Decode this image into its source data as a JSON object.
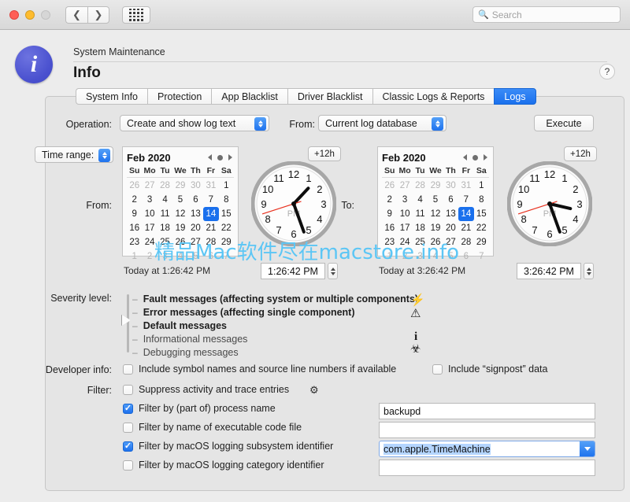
{
  "window": {
    "search_placeholder": "Search",
    "search_icon": "search-icon",
    "nav_back_icon": "chevron-left-icon",
    "nav_forward_icon": "chevron-right-icon",
    "grid_icon": "grid-dots-icon"
  },
  "header": {
    "breadcrumb": "System Maintenance",
    "title": "Info",
    "help_label": "?",
    "app_icon_glyph": "i"
  },
  "tabs": [
    {
      "label": "System Info",
      "active": false
    },
    {
      "label": "Protection",
      "active": false
    },
    {
      "label": "App Blacklist",
      "active": false
    },
    {
      "label": "Driver Blacklist",
      "active": false
    },
    {
      "label": "Classic Logs & Reports",
      "active": false
    },
    {
      "label": "Logs",
      "active": true
    }
  ],
  "toolbar": {
    "operation_label": "Operation:",
    "operation_value": "Create and show log text",
    "from_label": "From:",
    "from_value": "Current log database",
    "execute_label": "Execute"
  },
  "time_range": {
    "popup_label": "Time range:",
    "from_label": "From:",
    "to_label": "To:",
    "plus12_label": "+12h"
  },
  "calendar_from": {
    "month": "Feb 2020",
    "dow": [
      "Su",
      "Mo",
      "Tu",
      "We",
      "Th",
      "Fr",
      "Sa"
    ],
    "weeks": [
      [
        {
          "d": "26",
          "out": true
        },
        {
          "d": "27",
          "out": true
        },
        {
          "d": "28",
          "out": true
        },
        {
          "d": "29",
          "out": true
        },
        {
          "d": "30",
          "out": true
        },
        {
          "d": "31",
          "out": true
        },
        {
          "d": "1"
        }
      ],
      [
        {
          "d": "2"
        },
        {
          "d": "3"
        },
        {
          "d": "4"
        },
        {
          "d": "5"
        },
        {
          "d": "6"
        },
        {
          "d": "7"
        },
        {
          "d": "8"
        }
      ],
      [
        {
          "d": "9"
        },
        {
          "d": "10"
        },
        {
          "d": "11"
        },
        {
          "d": "12"
        },
        {
          "d": "13"
        },
        {
          "d": "14",
          "sel": true
        },
        {
          "d": "15"
        }
      ],
      [
        {
          "d": "16"
        },
        {
          "d": "17"
        },
        {
          "d": "18"
        },
        {
          "d": "19"
        },
        {
          "d": "20"
        },
        {
          "d": "21"
        },
        {
          "d": "22"
        }
      ],
      [
        {
          "d": "23"
        },
        {
          "d": "24"
        },
        {
          "d": "25"
        },
        {
          "d": "26"
        },
        {
          "d": "27"
        },
        {
          "d": "28"
        },
        {
          "d": "29"
        }
      ],
      [
        {
          "d": "1",
          "out": true
        },
        {
          "d": "2",
          "out": true
        },
        {
          "d": "3",
          "out": true
        },
        {
          "d": "4",
          "out": true
        },
        {
          "d": "5",
          "out": true
        },
        {
          "d": "6",
          "out": true
        },
        {
          "d": "7",
          "out": true
        }
      ]
    ],
    "today_text": "Today at 1:26:42 PM",
    "time_value": "1:26:42 PM",
    "clock_meridiem": "PM",
    "clock_hour": 1,
    "clock_minute": 26,
    "clock_second": 42
  },
  "calendar_to": {
    "month": "Feb 2020",
    "dow": [
      "Su",
      "Mo",
      "Tu",
      "We",
      "Th",
      "Fr",
      "Sa"
    ],
    "weeks": [
      [
        {
          "d": "26",
          "out": true
        },
        {
          "d": "27",
          "out": true
        },
        {
          "d": "28",
          "out": true
        },
        {
          "d": "29",
          "out": true
        },
        {
          "d": "30",
          "out": true
        },
        {
          "d": "31",
          "out": true
        },
        {
          "d": "1"
        }
      ],
      [
        {
          "d": "2"
        },
        {
          "d": "3"
        },
        {
          "d": "4"
        },
        {
          "d": "5"
        },
        {
          "d": "6"
        },
        {
          "d": "7"
        },
        {
          "d": "8"
        }
      ],
      [
        {
          "d": "9"
        },
        {
          "d": "10"
        },
        {
          "d": "11"
        },
        {
          "d": "12"
        },
        {
          "d": "13"
        },
        {
          "d": "14",
          "sel": true
        },
        {
          "d": "15"
        }
      ],
      [
        {
          "d": "16"
        },
        {
          "d": "17"
        },
        {
          "d": "18"
        },
        {
          "d": "19"
        },
        {
          "d": "20"
        },
        {
          "d": "21"
        },
        {
          "d": "22"
        }
      ],
      [
        {
          "d": "23"
        },
        {
          "d": "24"
        },
        {
          "d": "25"
        },
        {
          "d": "26"
        },
        {
          "d": "27"
        },
        {
          "d": "28"
        },
        {
          "d": "29"
        }
      ],
      [
        {
          "d": "1",
          "out": true
        },
        {
          "d": "2",
          "out": true
        },
        {
          "d": "3",
          "out": true
        },
        {
          "d": "4",
          "out": true
        },
        {
          "d": "5",
          "out": true
        },
        {
          "d": "6",
          "out": true
        },
        {
          "d": "7",
          "out": true
        }
      ]
    ],
    "today_text": "Today at 3:26:42 PM",
    "time_value": "3:26:42 PM",
    "clock_meridiem": "PM",
    "clock_hour": 3,
    "clock_minute": 26,
    "clock_second": 42
  },
  "severity": {
    "label": "Severity level:",
    "selected_index": 2,
    "levels": [
      {
        "text": "Fault messages (affecting system or multiple components)",
        "bold": true
      },
      {
        "text": "Error messages (affecting single component)",
        "bold": true
      },
      {
        "text": "Default messages",
        "bold": true
      },
      {
        "text": "Informational messages",
        "bold": false
      },
      {
        "text": "Debugging messages",
        "bold": false
      }
    ],
    "icons": [
      "lightning-bolt-icon",
      "warning-triangle-icon",
      "info-i-icon",
      "biohazard-icon"
    ],
    "icon_glyphs": [
      "⚡",
      "⚠",
      "i",
      "☣"
    ]
  },
  "developer_info": {
    "label": "Developer info:",
    "symbol_names": {
      "text": "Include symbol names and source line numbers if available",
      "checked": false
    },
    "signpost": {
      "text": "Include “signpost” data",
      "checked": false
    }
  },
  "filter": {
    "label": "Filter:",
    "suppress": {
      "text": "Suppress activity and trace entries",
      "checked": false
    },
    "gear_icon": "gear-icon",
    "rows": [
      {
        "text": "Filter by (part of) process name",
        "checked": true,
        "value": "backupd",
        "type": "text"
      },
      {
        "text": "Filter by name of executable code file",
        "checked": false,
        "value": "",
        "type": "text"
      },
      {
        "text": "Filter by macOS logging subsystem identifier",
        "checked": true,
        "value": "com.apple.TimeMachine",
        "type": "combo"
      },
      {
        "text": "Filter by macOS logging category identifier",
        "checked": false,
        "value": "",
        "type": "text"
      }
    ]
  },
  "watermark": {
    "text": "精品Mac软件尽在macstore.info"
  },
  "colors": {
    "accent": "#1a70ed",
    "selection": "#b4d5fe",
    "window_bg": "#ececec",
    "panel_bg": "#e5e5e5",
    "watermark": "#5cc6f5"
  }
}
